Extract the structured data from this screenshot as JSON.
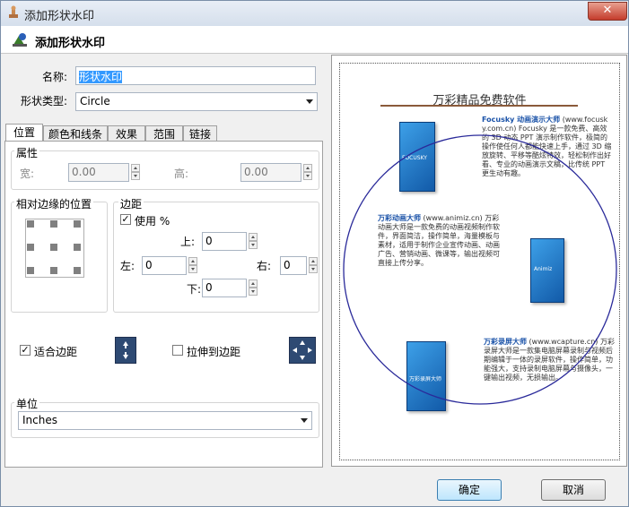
{
  "window": {
    "title": "添加形状水印",
    "close_symbol": "✕",
    "header_title": "添加形状水印"
  },
  "form": {
    "name_label": "名称:",
    "name_value": "形状水印",
    "shape_type_label": "形状类型:",
    "shape_type_value": "Circle"
  },
  "tabs": [
    "位置",
    "颜色和线条",
    "效果",
    "范围",
    "链接"
  ],
  "position_tab": {
    "attributes_group": "属性",
    "width_label": "宽:",
    "width_value": "0.00",
    "height_label": "高:",
    "height_value": "0.00",
    "relative_group": "相对边缘的位置",
    "margin_group": "边距",
    "use_percent_label": "使用 %",
    "use_percent_checked": true,
    "top_label": "上:",
    "top_value": "0",
    "left_label": "左:",
    "left_value": "0",
    "right_label": "右:",
    "right_value": "0",
    "bottom_label": "下:",
    "bottom_value": "0",
    "fit_margin_label": "适合边距",
    "fit_margin_checked": true,
    "stretch_label": "拉伸到边距",
    "stretch_checked": false,
    "unit_group": "单位",
    "unit_value": "Inches"
  },
  "preview": {
    "doc_title": "万彩精品免费软件",
    "section1_heading": "Focusky 动画演示大师",
    "section1_url": "(www.focusky.com.cn)",
    "section1_text": "Focusky 是一款免费、高效的 3D 动态 PPT 演示制作软件，极简的操作使任何人都能快速上手，通过 3D 缩放旋转、平移等酷炫特效，轻松制作出好看、专业的动画演示文稿，比传统 PPT 更生动有趣。",
    "section2_heading": "万彩动画大师",
    "section2_url": "(www.animiz.cn)",
    "section2_text": "万彩动画大师是一款免费的动画视频制作软件，界面简洁，操作简单，海量模板与素材，适用于制作企业宣传动画、动画广告、营销动画、微课等，输出视频可直接上传分享。",
    "section3_heading": "万彩录屏大师",
    "section3_url": "(www.wcapture.cn)",
    "section3_text": "万彩录屏大师是一款集电脑屏幕录制与视频后期编辑于一体的录屏软件，操作简单，功能强大，支持录制电脑屏幕与摄像头，一键输出视频，无损输出。",
    "box1_label": "FOCUSKY",
    "box2_label": "Animiz",
    "box3_label": "万彩录屏大师"
  },
  "buttons": {
    "ok": "确定",
    "cancel": "取消"
  },
  "colors": {
    "circle_stroke": "#2a2a9a",
    "accent_blue": "#1a52a8"
  }
}
